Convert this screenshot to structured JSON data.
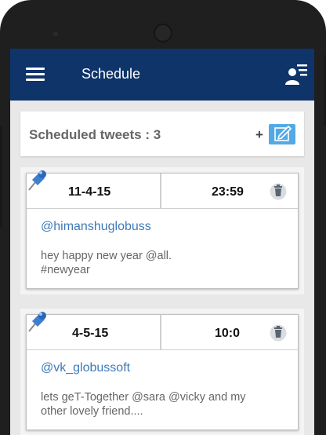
{
  "app": {
    "title": "Schedule"
  },
  "header": {
    "count_label": "Scheduled tweets : 3",
    "add_label": "+"
  },
  "tweets": [
    {
      "date": "11-4-15",
      "time": "23:59",
      "handle": "@himanshuglobuss",
      "text": "hey happy new year @all.\n#newyear"
    },
    {
      "date": "4-5-15",
      "time": "10:0",
      "handle": "@vk_globussoft",
      "text": "lets geT-Together @sara @vicky and my\nother lovely friend...."
    }
  ],
  "colors": {
    "appbar": "#0e3469",
    "accent": "#53a9e4",
    "handle": "#3d7ab8"
  },
  "icons": {
    "menu": "hamburger-menu-icon",
    "user": "user-list-icon",
    "edit": "edit-pencil-icon",
    "pin": "pushpin-icon",
    "delete": "trash-icon"
  }
}
